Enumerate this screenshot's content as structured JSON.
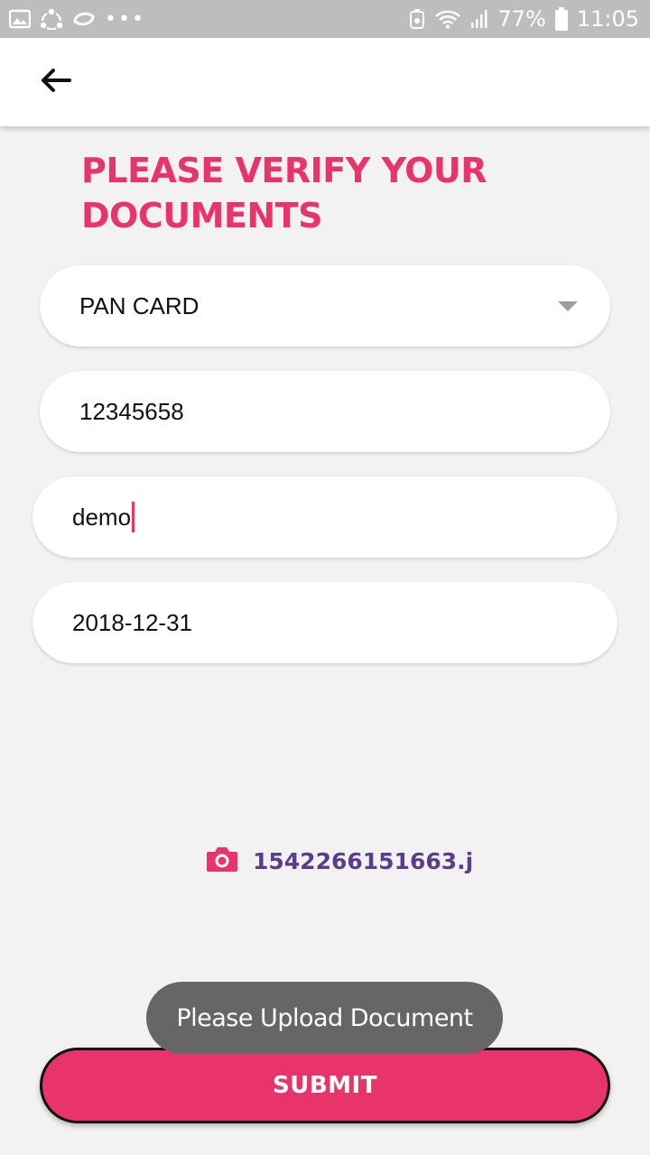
{
  "status_bar": {
    "battery_percent": "77%",
    "time": "11:05",
    "overflow_dots": "•••",
    "icons": [
      "gallery-icon",
      "share-icon",
      "sync-icon",
      "recycle-icon",
      "wifi-icon",
      "signal-icon",
      "battery-icon"
    ]
  },
  "header": {
    "back_icon": "arrow-left-icon"
  },
  "page": {
    "title": "PLEASE VERIFY YOUR DOCUMENTS"
  },
  "form": {
    "document_type": {
      "selected": "PAN CARD"
    },
    "document_number": {
      "value": "12345658"
    },
    "name": {
      "value": "demo"
    },
    "date": {
      "value": "2018-12-31"
    }
  },
  "upload": {
    "icon": "camera-icon",
    "filename": "1542266151663.j"
  },
  "toast": {
    "message": "Please Upload Document"
  },
  "submit": {
    "label": "SUBMIT"
  },
  "colors": {
    "accent": "#e8346a",
    "filename": "#5a3d8c",
    "background": "#f2f2f2",
    "toast": "#666666",
    "status_bar": "#bdbdbd"
  }
}
